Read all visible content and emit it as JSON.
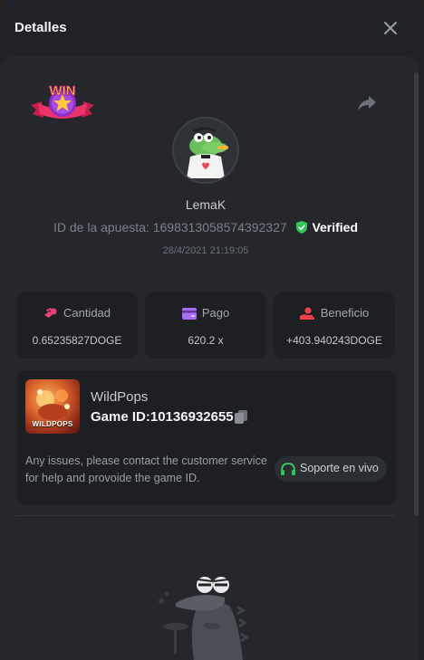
{
  "header": {
    "title": "Detalles"
  },
  "bet": {
    "username": "LemaK",
    "id_label": "ID de la apuesta:",
    "id_value": "1698313058574392327",
    "verified_label": "Verified",
    "datetime": "28/4/2021 21:19:05",
    "badge_text": "WIN"
  },
  "stats": [
    {
      "label": "Cantidad",
      "value": "0.65235827DOGE",
      "icon": "coins-icon",
      "color": "#f0407a"
    },
    {
      "label": "Pago",
      "value": "620.2 x",
      "icon": "card-icon",
      "color": "#a96cf5"
    },
    {
      "label": "Beneficio",
      "value": "+403.940243DOGE",
      "icon": "hand-coin-icon",
      "color": "#f0424a"
    }
  ],
  "game": {
    "name": "WildPops",
    "thumb_text": "WILDPOPS",
    "id_label": "Game ID:",
    "id_value": "10136932655",
    "help_text": "Any issues, please contact the customer service for help and provoide the game ID.",
    "support_label": "Soporte en vivo"
  },
  "colors": {
    "accent_green": "#31c65a",
    "panel": "#25272c",
    "card": "#1d1f23"
  }
}
